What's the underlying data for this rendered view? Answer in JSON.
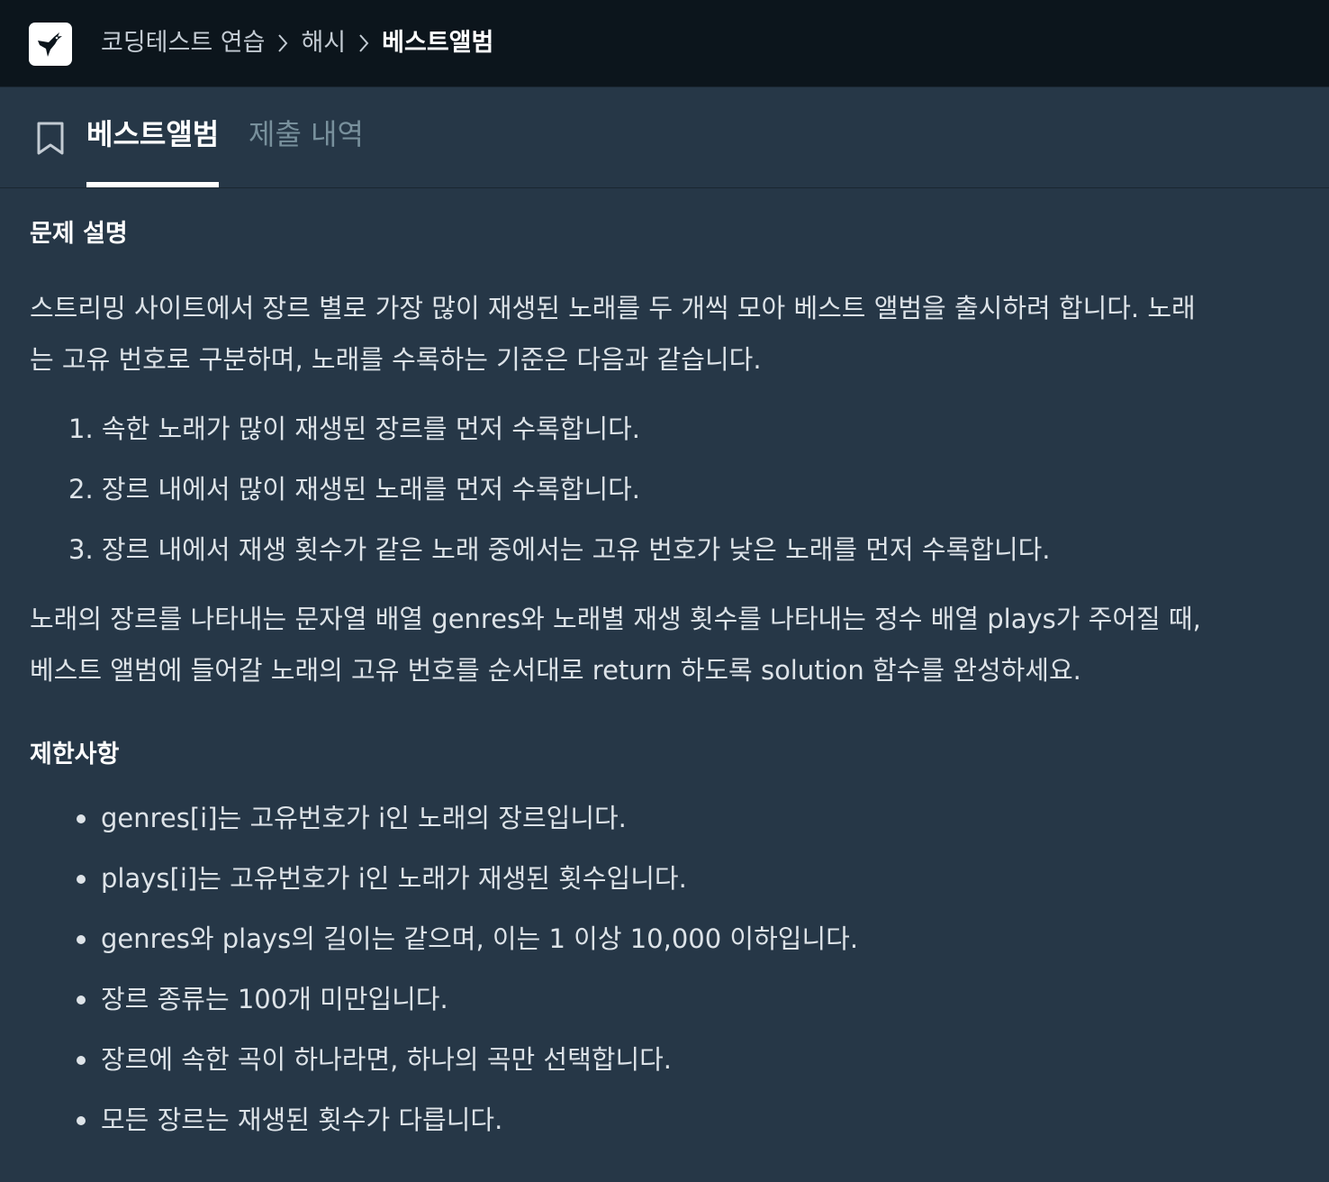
{
  "header": {
    "breadcrumb": [
      {
        "label": "코딩테스트 연습"
      },
      {
        "label": "해시"
      },
      {
        "label": "베스트앨범"
      }
    ]
  },
  "tabs": [
    {
      "label": "베스트앨범",
      "active": true
    },
    {
      "label": "제출 내역",
      "active": false
    }
  ],
  "problem": {
    "description_title": "문제 설명",
    "intro_line1": "스트리밍 사이트에서 장르 별로 가장 많이 재생된 노래를 두 개씩 모아 베스트 앨범을 출시하려 합니다. 노래",
    "intro_line2": "는 고유 번호로 구분하며, 노래를 수록하는 기준은 다음과 같습니다.",
    "rules": [
      "1. 속한 노래가 많이 재생된 장르를 먼저 수록합니다.",
      "2. 장르 내에서 많이 재생된 노래를 먼저 수록합니다.",
      "3. 장르 내에서 재생 횟수가 같은 노래 중에서는 고유 번호가 낮은 노래를 먼저 수록합니다."
    ],
    "task_line1": "노래의 장르를 나타내는 문자열 배열 genres와 노래별 재생 횟수를 나타내는 정수 배열 plays가 주어질 때,",
    "task_line2": "베스트 앨범에 들어갈 노래의 고유 번호를 순서대로 return 하도록 solution 함수를 완성하세요.",
    "constraints_title": "제한사항",
    "constraints": [
      "genres[i]는 고유번호가 i인 노래의 장르입니다.",
      "plays[i]는 고유번호가 i인 노래가 재생된 횟수입니다.",
      "genres와 plays의 길이는 같으며, 이는 1 이상 10,000 이하입니다.",
      "장르 종류는 100개 미만입니다.",
      "장르에 속한 곡이 하나라면, 하나의 곡만 선택합니다.",
      "모든 장르는 재생된 횟수가 다릅니다."
    ]
  },
  "colors": {
    "topbar_bg": "#0c151c",
    "page_bg": "#263747",
    "text": "#dde3e8",
    "inactive_tab": "#78909c"
  },
  "icons": {
    "logo": "hummingbird-logo-icon",
    "breadcrumb_separator": "chevron-right-icon",
    "tab": "bookmark-icon"
  }
}
